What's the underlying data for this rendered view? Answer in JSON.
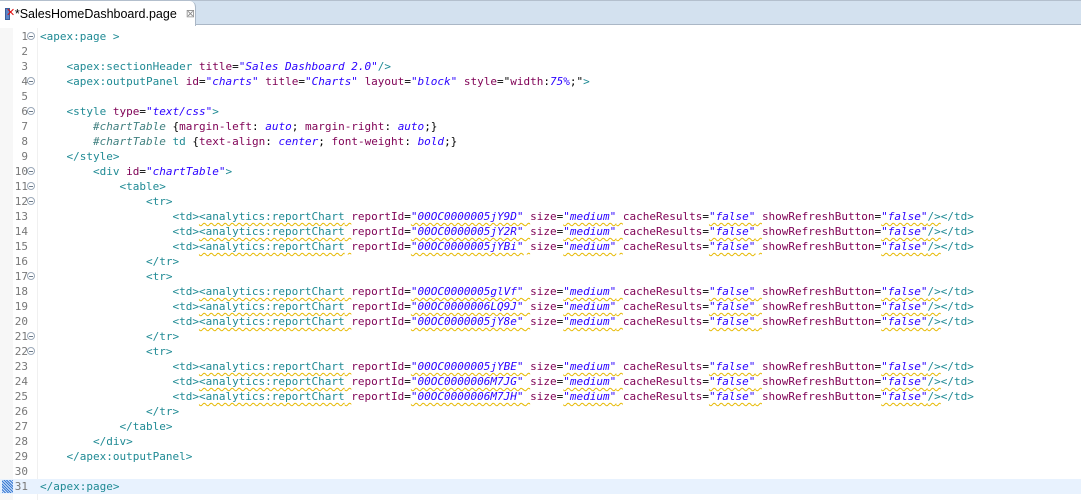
{
  "tab": {
    "icon": "visualforce-page-icon",
    "title": "*SalesHomeDashboard.page",
    "close_icon": "close-tab-icon"
  },
  "editor": {
    "current_line": 31,
    "fold_lines": [
      1,
      4,
      6,
      10,
      11,
      12,
      17,
      21,
      22
    ],
    "lines": [
      {
        "n": "1",
        "indent": "",
        "tokens": [
          [
            "t",
            "<apex:page >"
          ]
        ]
      },
      {
        "n": "2",
        "indent": "",
        "tokens": []
      },
      {
        "n": "3",
        "indent": "    ",
        "tokens": [
          [
            "t",
            "<apex:sectionHeader "
          ],
          [
            "a",
            "title"
          ],
          [
            "p",
            "="
          ],
          [
            "v",
            "\"Sales Dashboard 2.0\""
          ],
          [
            "t",
            "/>"
          ]
        ]
      },
      {
        "n": "4",
        "indent": "    ",
        "tokens": [
          [
            "t",
            "<apex:outputPanel "
          ],
          [
            "a",
            "id"
          ],
          [
            "p",
            "="
          ],
          [
            "v",
            "\"charts\""
          ],
          [
            "p",
            " "
          ],
          [
            "a",
            "title"
          ],
          [
            "p",
            "="
          ],
          [
            "v",
            "\"Charts\""
          ],
          [
            "p",
            " "
          ],
          [
            "a",
            "layout"
          ],
          [
            "p",
            "="
          ],
          [
            "v",
            "\"block\""
          ],
          [
            "p",
            " "
          ],
          [
            "a",
            "style"
          ],
          [
            "p",
            "=\""
          ],
          [
            "cp",
            "width"
          ],
          [
            "p",
            ":"
          ],
          [
            "cv",
            "75%"
          ],
          [
            "p",
            ";\""
          ],
          [
            "t",
            ">"
          ]
        ]
      },
      {
        "n": "5",
        "indent": "",
        "tokens": []
      },
      {
        "n": "6",
        "indent": "    ",
        "tokens": [
          [
            "t",
            "<style "
          ],
          [
            "a",
            "type"
          ],
          [
            "p",
            "="
          ],
          [
            "v",
            "\"text/css\""
          ],
          [
            "t",
            ">"
          ]
        ]
      },
      {
        "n": "7",
        "indent": "        ",
        "tokens": [
          [
            "ci",
            "#chartTable"
          ],
          [
            "p",
            " {"
          ],
          [
            "cp",
            "margin-left"
          ],
          [
            "p",
            ": "
          ],
          [
            "cv",
            "auto"
          ],
          [
            "p",
            "; "
          ],
          [
            "cp",
            "margin-right"
          ],
          [
            "p",
            ": "
          ],
          [
            "cv",
            "auto"
          ],
          [
            "p",
            ";}"
          ]
        ]
      },
      {
        "n": "8",
        "indent": "        ",
        "tokens": [
          [
            "ci",
            "#chartTable"
          ],
          [
            "p",
            " "
          ],
          [
            "t",
            "td"
          ],
          [
            "p",
            " {"
          ],
          [
            "cp",
            "text-align"
          ],
          [
            "p",
            ": "
          ],
          [
            "cv",
            "center"
          ],
          [
            "p",
            "; "
          ],
          [
            "cp",
            "font-weight"
          ],
          [
            "p",
            ": "
          ],
          [
            "cv",
            "bold"
          ],
          [
            "p",
            ";}"
          ]
        ]
      },
      {
        "n": "9",
        "indent": "    ",
        "tokens": [
          [
            "t",
            "</style>"
          ]
        ]
      },
      {
        "n": "10",
        "indent": "        ",
        "tokens": [
          [
            "t",
            "<div "
          ],
          [
            "a",
            "id"
          ],
          [
            "p",
            "="
          ],
          [
            "v",
            "\"chartTable\""
          ],
          [
            "t",
            ">"
          ]
        ]
      },
      {
        "n": "11",
        "indent": "            ",
        "tokens": [
          [
            "t",
            "<table>"
          ]
        ]
      },
      {
        "n": "12",
        "indent": "                ",
        "tokens": [
          [
            "t",
            "<tr>"
          ]
        ]
      },
      {
        "n": "13",
        "indent": "                    ",
        "chart": "00OC0000005jY9D"
      },
      {
        "n": "14",
        "indent": "                    ",
        "chart": "00OC0000005jY2R"
      },
      {
        "n": "15",
        "indent": "                    ",
        "chart": "00OC0000005jYBi"
      },
      {
        "n": "16",
        "indent": "                ",
        "tokens": [
          [
            "t",
            "</tr>"
          ]
        ]
      },
      {
        "n": "17",
        "indent": "                ",
        "tokens": [
          [
            "t",
            "<tr>"
          ]
        ]
      },
      {
        "n": "18",
        "indent": "                    ",
        "chart": "00OC0000005glVf"
      },
      {
        "n": "19",
        "indent": "                    ",
        "chart": "00OC0000006LQ9J"
      },
      {
        "n": "20",
        "indent": "                    ",
        "chart": "00OC0000005jY8e"
      },
      {
        "n": "21",
        "indent": "                ",
        "tokens": [
          [
            "t",
            "</tr>"
          ]
        ]
      },
      {
        "n": "22",
        "indent": "                ",
        "tokens": [
          [
            "t",
            "<tr>"
          ]
        ]
      },
      {
        "n": "23",
        "indent": "                    ",
        "chart": "00OC0000005jYBE"
      },
      {
        "n": "24",
        "indent": "                    ",
        "chart": "00OC0000006M7JG"
      },
      {
        "n": "25",
        "indent": "                    ",
        "chart": "00OC0000006M7JH"
      },
      {
        "n": "26",
        "indent": "                ",
        "tokens": [
          [
            "t",
            "</tr>"
          ]
        ]
      },
      {
        "n": "27",
        "indent": "            ",
        "tokens": [
          [
            "t",
            "</table>"
          ]
        ]
      },
      {
        "n": "28",
        "indent": "        ",
        "tokens": [
          [
            "t",
            "</div>"
          ]
        ]
      },
      {
        "n": "29",
        "indent": "    ",
        "tokens": [
          [
            "t",
            "</apex:outputPanel>"
          ]
        ]
      },
      {
        "n": "30",
        "indent": "",
        "tokens": []
      },
      {
        "n": "31",
        "indent": "",
        "tokens": [
          [
            "t",
            "</apex:page>"
          ]
        ]
      }
    ],
    "chart_template": {
      "open_td": "<td>",
      "tag": "<analytics:reportChart",
      "attr_report": "reportId",
      "attr_size": "size",
      "size_value": "\"medium\"",
      "attr_cache": "cacheResults",
      "cache_value": "\"false\"",
      "attr_refresh": "showRefreshButton",
      "refresh_value": "\"false\"",
      "self_close": "/>",
      "close_td": "</td>"
    }
  },
  "colors": {
    "tab_bar": "#d3e1ef",
    "current_line": "#e8f2fe",
    "tag": "#1f8a94",
    "attribute": "#7f0055",
    "value": "#2a00ff",
    "warning_underline": "#e6b800"
  }
}
